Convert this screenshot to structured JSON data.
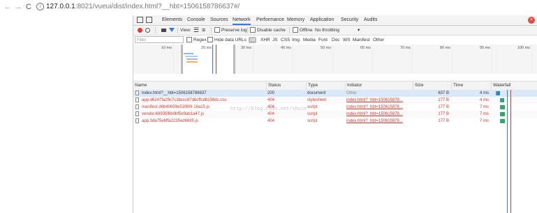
{
  "browser": {
    "url_host": "127.0.0.1",
    "url_rest": ":8021/vueui/dist/index.html?__hbt=1506158786637#/"
  },
  "devtools": {
    "tabs": [
      "Elements",
      "Console",
      "Sources",
      "Network",
      "Performance",
      "Memory",
      "Application",
      "Security",
      "Audits"
    ],
    "active_tab": "Network",
    "toolbar": {
      "view_label": "View:",
      "preserve_log": "Preserve log",
      "disable_cache": "Disable cache",
      "offline": "Offline",
      "throttling": "No throttling"
    },
    "filter": {
      "placeholder": "Filter",
      "regex": "Regex",
      "hide_data_urls": "Hide data URLs",
      "types": [
        "All",
        "XHR",
        "JS",
        "CSS",
        "Img",
        "Media",
        "Font",
        "Doc",
        "WS",
        "Manifest",
        "Other"
      ],
      "selected_type": "All"
    },
    "timeline": {
      "ticks": [
        "10 ms",
        "20 ms",
        "30 ms",
        "40 ms",
        "50 ms",
        "60 ms",
        "70 ms",
        "80 ms",
        "90 ms",
        "100 ms"
      ]
    },
    "table": {
      "headers": [
        "Name",
        "Status",
        "Type",
        "Initiator",
        "Size",
        "Time",
        "Waterfall"
      ],
      "rows": [
        {
          "name": "index.html?__hbt=1506158786637",
          "status": "200",
          "type": "document",
          "initiator": "Other",
          "size": "637 B",
          "time": "4 ms",
          "error": false,
          "selected": true
        },
        {
          "name": "app.d6247fa29c7c3bccc87d6cffcd6156dc.css",
          "status": "404",
          "type": "stylesheet",
          "initiator": "index.html?_hbt=150615878...",
          "size": "177 B",
          "time": "4 ms",
          "error": true,
          "selected": false
        },
        {
          "name": "manifest.d6b40659e51f806 16a15.js",
          "status": "404",
          "type": "script",
          "initiator": "index.html?_hbt=150615878...",
          "size": "177 B",
          "time": "7 ms",
          "error": true,
          "selected": false
        },
        {
          "name": "vendor.68935f6b0bf5e9ab1a47.js",
          "status": "404",
          "type": "script",
          "initiator": "index.html?_hbt=150615878...",
          "size": "177 B",
          "time": "7 ms",
          "error": true,
          "selected": false
        },
        {
          "name": "app.3da75ebffa2235ed6695.js",
          "status": "404",
          "type": "script",
          "initiator": "index.html?_hbt=150615878...",
          "size": "177 B",
          "time": "7 ms",
          "error": true,
          "selected": false
        }
      ]
    },
    "watermark": "http://blog.csdn.net/shuie"
  },
  "colors": {
    "error": "#e0342b",
    "selected_row": "#dae9f9",
    "accent": "#3879d9"
  }
}
